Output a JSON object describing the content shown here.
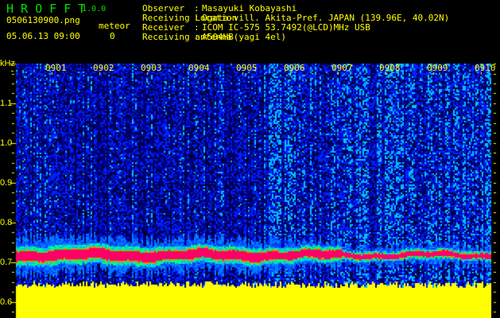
{
  "app": {
    "title_letters": "H R O F F T",
    "version": "1.0.0"
  },
  "file": {
    "name": "0506130900.png",
    "datetime": "05.06.13 09:00"
  },
  "meteor": {
    "label": "meteor",
    "count": "0"
  },
  "info": [
    {
      "label": "Observer",
      "value": "Masayuki Kobayashi"
    },
    {
      "label": "Receiving Location",
      "value": "Ogata-vill. Akita-Pref. JAPAN (139.96E, 40.02N)"
    },
    {
      "label": "Receiver",
      "value": "ICOM IC-575 53.7492(@LCD)MHz USB"
    },
    {
      "label": "Receiving antenna",
      "value": "A504HB(yagi 4el)"
    }
  ],
  "chart_data": {
    "type": "heatmap",
    "ylabel": "kHz",
    "ylim": [
      0.55,
      1.2
    ],
    "yticks": [
      "1.1",
      "1.0",
      "0.9",
      "0.8",
      "0.7",
      "0.6"
    ],
    "ytick_values": [
      1.1,
      1.0,
      0.9,
      0.8,
      0.7,
      0.6
    ],
    "xticks": [
      "0901",
      "0902",
      "0903",
      "0904",
      "0905",
      "0906",
      "0907",
      "0908",
      "0909",
      "0910"
    ],
    "signal_band_khz": 0.72,
    "noise_floor_top_khz": 0.65,
    "colors": {
      "text": "#ffff00",
      "title": "#00e000",
      "strong": "#ff0066",
      "noise": "#0000c0",
      "floor": "#ffff00"
    }
  }
}
